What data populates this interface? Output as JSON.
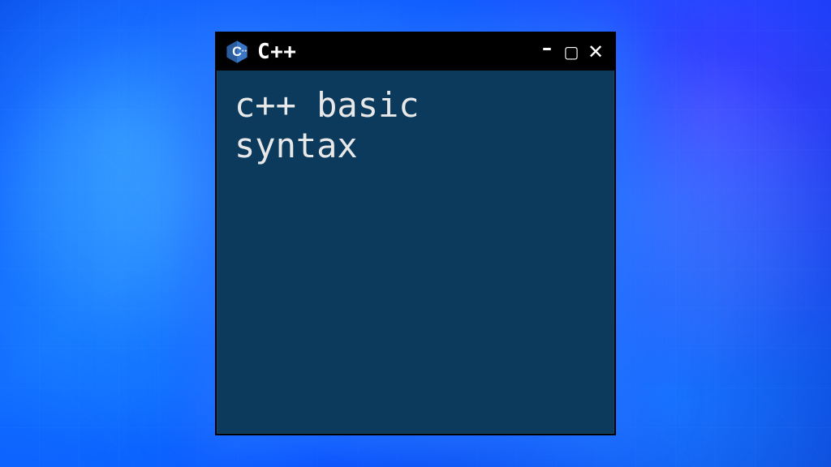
{
  "window": {
    "title": "C++",
    "controls": {
      "minimize_glyph": "–",
      "maximize_glyph": "▢",
      "close_glyph": "✕"
    }
  },
  "terminal": {
    "content": "c++ basic\nsyntax"
  },
  "colors": {
    "window_bg": "#0c3a5c",
    "titlebar_bg": "#000000",
    "glow": "#2878ff"
  }
}
